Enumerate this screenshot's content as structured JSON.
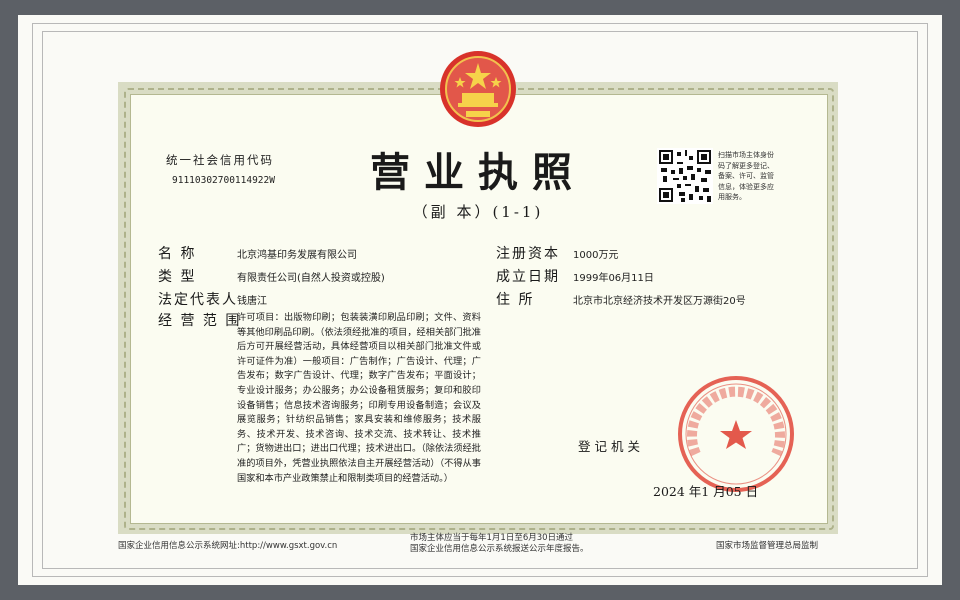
{
  "certificate": {
    "title": "营业执照",
    "subtitle": "（副  本）(1-1)",
    "credit_code_label": "统一社会信用代码",
    "credit_code": "91110302700114922W",
    "qr_note": "扫描市场主体身份码了解更多登记、备案、许可、监管信息，体验更多应用服务。",
    "fields": {
      "name_label": "名        称",
      "name": "北京鸿基印务发展有限公司",
      "type_label": "类        型",
      "type": "有限责任公司(自然人投资或控股)",
      "rep_label": "法定代表人",
      "rep": "钱唐江",
      "scope_label": "经 营 范 围",
      "scope": "许可项目：出版物印刷；包装装潢印刷品印刷；文件、资料等其他印刷品印刷。（依法须经批准的项目，经相关部门批准后方可开展经营活动，具体经营项目以相关部门批准文件或许可证件为准）一般项目：广告制作；广告设计、代理；广告发布；数字广告设计、代理；数字广告发布；平面设计；专业设计服务；办公服务；办公设备租赁服务；复印和胶印设备销售；信息技术咨询服务；印刷专用设备制造；会议及展览服务；针纺织品销售；家具安装和维修服务；技术服务、技术开发、技术咨询、技术交流、技术转让、技术推广；货物进出口；进出口代理；技术进出口。（除依法须经批准的项目外，凭营业执照依法自主开展经营活动）（不得从事国家和本市产业政策禁止和限制类项目的经营活动。）",
      "capital_label": "注册资本",
      "capital": "1000万元",
      "est_label": "成立日期",
      "est": "1999年06月11日",
      "addr_label": "住        所",
      "addr": "北京市北京经济技术开发区万源街20号"
    },
    "registration_org": "登记机关",
    "issue_date": "2024  年1  月05  日",
    "seal_text": "北京经济技术开发区市场监督管理局",
    "footer_left": "国家企业信用信息公示系统网址:",
    "footer_url": "http://www.gsxt.gov.cn",
    "footer_middle_1": "市场主体应当于每年1月1日至6月30日通过",
    "footer_middle_2": "国家企业信用信息公示系统报送公示年度报告。",
    "footer_right": "国家市场监督管理总局监制",
    "seal_color": "#e0473a",
    "emblem_color": "#d8322b"
  }
}
